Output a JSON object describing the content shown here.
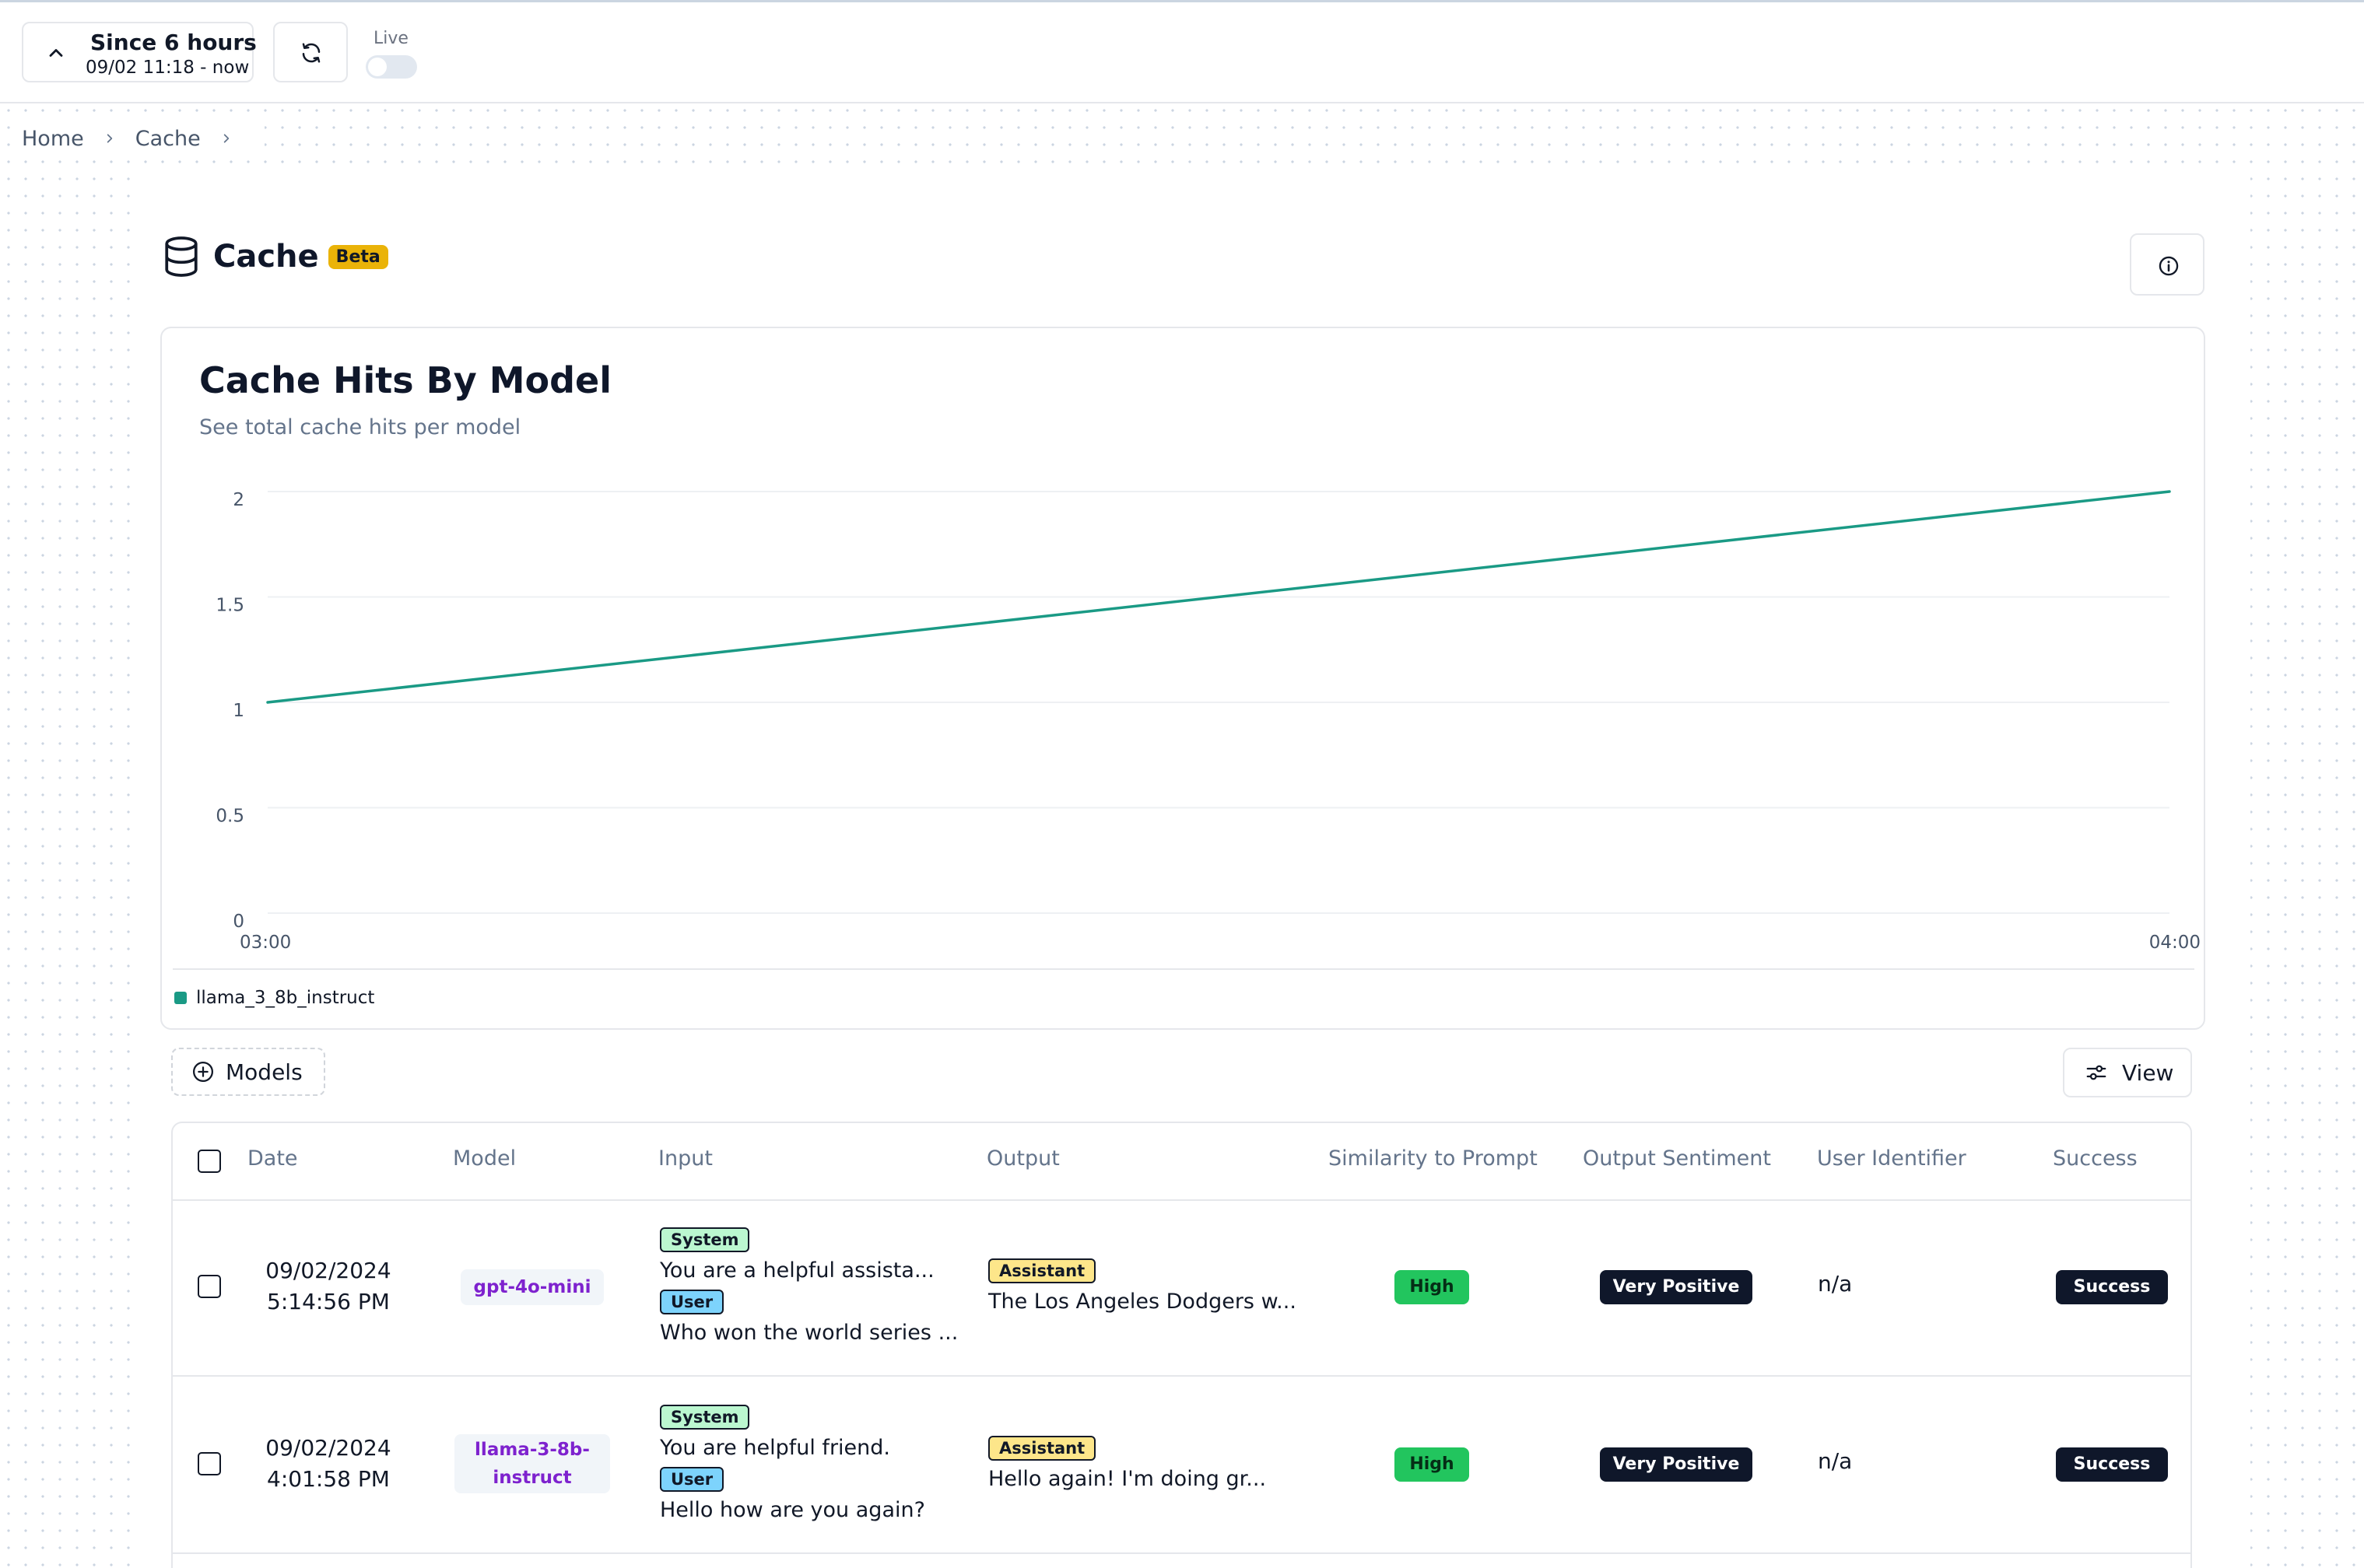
{
  "header": {
    "time_range_title": "Since 6 hours",
    "time_range_sub": "09/02 11:18 - now",
    "live_label": "Live",
    "live_enabled": false
  },
  "breadcrumb": [
    "Home",
    "Cache"
  ],
  "page": {
    "title": "Cache",
    "badge": "Beta"
  },
  "chart_data": {
    "type": "line",
    "title": "Cache Hits By Model",
    "subtitle": "See total cache hits per model",
    "x": [
      "03:00",
      "04:00"
    ],
    "y_ticks": [
      "0",
      "0.5",
      "1",
      "1.5",
      "2"
    ],
    "ylim": [
      0,
      2
    ],
    "grid": true,
    "legend_position": "bottom-left",
    "series": [
      {
        "name": "llama_3_8b_instruct",
        "values": [
          1,
          2
        ],
        "color": "#1a9a85"
      }
    ]
  },
  "toolbar": {
    "models_label": "Models",
    "view_label": "View"
  },
  "table": {
    "columns": [
      "Date",
      "Model",
      "Input",
      "Output",
      "Similarity to Prompt",
      "Output Sentiment",
      "User Identifier",
      "Success"
    ],
    "rows": [
      {
        "date": "09/02/2024",
        "time": "5:14:56 PM",
        "model": "gpt-4o-mini",
        "input_system_role": "System",
        "input_system_text": "You are a helpful assista...",
        "input_user_role": "User",
        "input_user_text": "Who won the world series ...",
        "output_role": "Assistant",
        "output_text": "The Los Angeles Dodgers w...",
        "similarity": "High",
        "sentiment": "Very Positive",
        "user": "n/a",
        "success": "Success"
      },
      {
        "date": "09/02/2024",
        "time": "4:01:58 PM",
        "model_line1": "llama-3-8b-",
        "model_line2": "instruct",
        "input_system_role": "System",
        "input_system_text": "You are helpful friend.",
        "input_user_role": "User",
        "input_user_text": "Hello how are you again?",
        "output_role": "Assistant",
        "output_text": "Hello again! I'm doing gr...",
        "similarity": "High",
        "sentiment": "Very Positive",
        "user": "n/a",
        "success": "Success"
      }
    ]
  },
  "colors": {
    "accent_line": "#1a9a85",
    "beta_badge": "#eab308",
    "high_pill": "#22c55e",
    "dark_pill": "#0f172a",
    "model_text": "#7e22ce"
  }
}
